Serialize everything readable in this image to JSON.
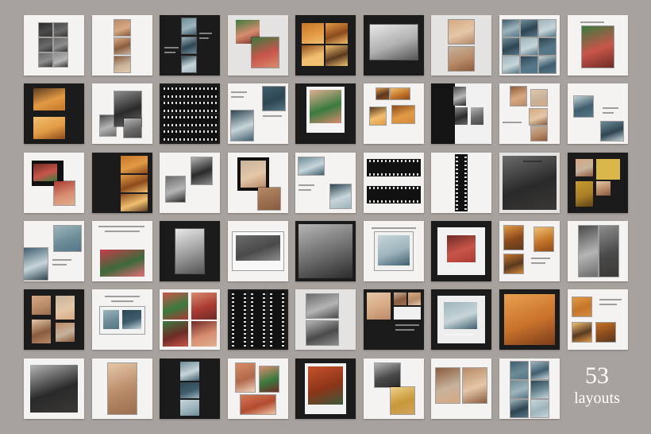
{
  "caption": {
    "count": "53",
    "label": "layouts"
  },
  "colors": {
    "background": "#a8a29e",
    "light_tile": "#f4f3f1",
    "grey_tile": "#e4e3e1",
    "dark_tile": "#1b1b1b",
    "caption_text": "#ffffff"
  },
  "tile_count": 53,
  "tiles": [
    {
      "bg": "light",
      "layout": "grid-2x3"
    },
    {
      "bg": "light",
      "layout": "vstack-3"
    },
    {
      "bg": "dark",
      "layout": "text-left-photos-right"
    },
    {
      "bg": "grey",
      "layout": "overlap-2"
    },
    {
      "bg": "dark",
      "layout": "grid-2x2"
    },
    {
      "bg": "dark",
      "layout": "big-landscape"
    },
    {
      "bg": "grey",
      "layout": "vstack-2"
    },
    {
      "bg": "light",
      "layout": "grid-3x3"
    },
    {
      "bg": "light",
      "layout": "text-top-big-photo"
    },
    {
      "bg": "dark",
      "layout": "hstack-2-wide"
    },
    {
      "bg": "light",
      "layout": "overlap-3"
    },
    {
      "bg": "dark",
      "layout": "film-grid"
    },
    {
      "bg": "light",
      "layout": "text-photos"
    },
    {
      "bg": "dark",
      "layout": "polaroid"
    },
    {
      "bg": "light",
      "layout": "collage-4"
    },
    {
      "bg": "dark",
      "layout": "split-photos"
    },
    {
      "bg": "light",
      "layout": "script-photos"
    },
    {
      "bg": "light",
      "layout": "photo-text-photo"
    },
    {
      "bg": "light",
      "layout": "overlap-dark-2"
    },
    {
      "bg": "dark",
      "layout": "vstack-3-right"
    },
    {
      "bg": "light",
      "layout": "two-polaroids"
    },
    {
      "bg": "light",
      "layout": "overlap-framed-2"
    },
    {
      "bg": "light",
      "layout": "photo-text-photo-2"
    },
    {
      "bg": "light",
      "layout": "film-rows"
    },
    {
      "bg": "light",
      "layout": "vertical-film"
    },
    {
      "bg": "grey",
      "layout": "full-bleed"
    },
    {
      "bg": "dark",
      "layout": "collage-yellow"
    },
    {
      "bg": "light",
      "layout": "magazine"
    },
    {
      "bg": "light",
      "layout": "text-top-photo"
    },
    {
      "bg": "dark",
      "layout": "centered-photo"
    },
    {
      "bg": "light",
      "layout": "wide-polaroid"
    },
    {
      "bg": "dark",
      "layout": "full-portrait"
    },
    {
      "bg": "light",
      "layout": "framed-center"
    },
    {
      "bg": "dark",
      "layout": "framed-center-light"
    },
    {
      "bg": "light",
      "layout": "collage-text"
    },
    {
      "bg": "light",
      "layout": "two-tall"
    },
    {
      "bg": "dark",
      "layout": "grid-2x2-offset"
    },
    {
      "bg": "light",
      "layout": "text-wide-photo"
    },
    {
      "bg": "light",
      "layout": "grid-2x2-light"
    },
    {
      "bg": "dark",
      "layout": "film-columns"
    },
    {
      "bg": "grey",
      "layout": "two-stack"
    },
    {
      "bg": "dark",
      "layout": "grid-light-mixed"
    },
    {
      "bg": "dark",
      "layout": "framed-small"
    },
    {
      "bg": "dark",
      "layout": "full-orange"
    },
    {
      "bg": "light",
      "layout": "grid-text"
    },
    {
      "bg": "light",
      "layout": "single-large"
    },
    {
      "bg": "light",
      "layout": "single-offset"
    },
    {
      "bg": "dark",
      "layout": "vstack-3-dark"
    },
    {
      "bg": "light",
      "layout": "polaroid-2"
    },
    {
      "bg": "dark",
      "layout": "single-red"
    },
    {
      "bg": "light",
      "layout": "two-diagonal"
    },
    {
      "bg": "light",
      "layout": "two-side"
    },
    {
      "bg": "light",
      "layout": "grid-5"
    }
  ]
}
